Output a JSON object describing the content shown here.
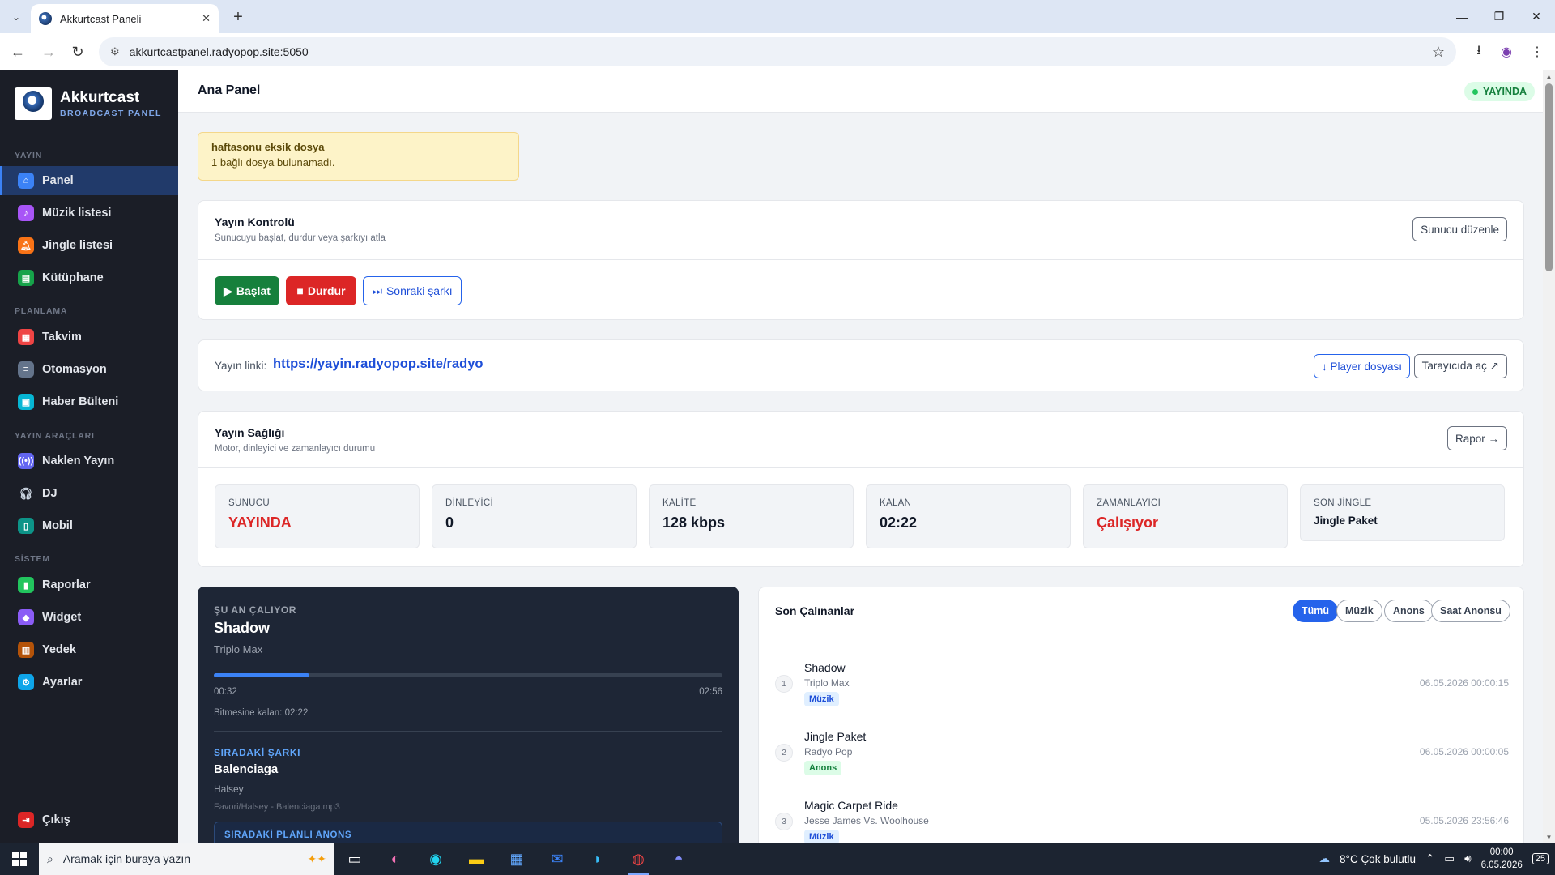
{
  "browser": {
    "tab_title": "Akkurtcast Paneli",
    "url": "akkurtcastpanel.radyopop.site:5050"
  },
  "sidebar": {
    "brand_name": "Akkurtcast",
    "brand_sub": "BROADCAST PANEL",
    "sections": {
      "yayin": "YAYIN",
      "planlama": "PLANLAMA",
      "araclar": "YAYIN ARAÇLARI",
      "sistem": "SİSTEM"
    },
    "items": {
      "panel": "Panel",
      "muzik": "Müzik listesi",
      "jingle": "Jingle listesi",
      "kutuphane": "Kütüphane",
      "takvim": "Takvim",
      "otomasyon": "Otomasyon",
      "haber": "Haber Bülteni",
      "naklen": "Naklen Yayın",
      "dj": "DJ",
      "mobil": "Mobil",
      "raporlar": "Raporlar",
      "widget": "Widget",
      "yedek": "Yedek",
      "ayarlar": "Ayarlar",
      "cikis": "Çıkış"
    }
  },
  "header": {
    "title": "Ana Panel",
    "status": "YAYINDA"
  },
  "alert": {
    "title": "haftasonu eksik dosya",
    "message": "1 bağlı dosya bulunamadı."
  },
  "control": {
    "title": "Yayın Kontrolü",
    "subtitle": "Sunucuyu başlat, durdur veya şarkıyı atla",
    "edit_button": "Sunucu düzenle",
    "start": "Başlat",
    "stop": "Durdur",
    "next": "Sonraki şarkı"
  },
  "stream": {
    "label": "Yayın linki:",
    "link": "https://yayin.radyopop.site/radyo",
    "player_button": "↓ Player dosyası",
    "browser_button": "Tarayıcıda aç ↗"
  },
  "health": {
    "title": "Yayın Sağlığı",
    "subtitle": "Motor, dinleyici ve zamanlayıcı durumu",
    "report_button": "Rapor →",
    "stats": [
      {
        "label": "SUNUCU",
        "value": "YAYINDA"
      },
      {
        "label": "DİNLEYİCİ",
        "value": "0"
      },
      {
        "label": "KALİTE",
        "value": "128 kbps"
      },
      {
        "label": "KALAN",
        "value": "02:22"
      },
      {
        "label": "ZAMANLAYICI",
        "value": "Çalışıyor"
      },
      {
        "label": "SON JİNGLE",
        "value": "Jingle Paket"
      }
    ]
  },
  "now_playing": {
    "label": "ŞU AN ÇALIYOR",
    "title": "Shadow",
    "artist": "Triplo Max",
    "progress": 0.188,
    "elapsed": "00:32",
    "duration": "02:56",
    "remaining": "Bitmesine kalan: 02:22",
    "next_label": "SIRADAKİ ŞARKI",
    "next_title": "Balenciaga",
    "next_artist": "Halsey",
    "next_path": "Favori/Halsey - Balenciaga.mp3",
    "planned_label": "SIRADAKİ PLANLI ANONS"
  },
  "recent": {
    "title": "Son Çalınanlar",
    "filters": [
      "Tümü",
      "Müzik",
      "Anons",
      "Saat Anonsu"
    ],
    "rows": [
      {
        "num": "1",
        "title": "Shadow",
        "artist": "Triplo Max",
        "tag": "Müzik",
        "time": "06.05.2026 00:00:15"
      },
      {
        "num": "2",
        "title": "Jingle Paket",
        "artist": "Radyo Pop",
        "tag": "Anons",
        "time": "06.05.2026 00:00:05"
      },
      {
        "num": "3",
        "title": "Magic Carpet Ride",
        "artist": "Jesse James Vs. Woolhouse",
        "tag": "Müzik",
        "time": "05.05.2026 23:56:46"
      }
    ]
  },
  "taskbar": {
    "search_placeholder": "Aramak için buraya yazın",
    "weather": "8°C  Çok bulutlu",
    "time": "00:00",
    "date": "6.05.2026",
    "notifications": "25"
  }
}
